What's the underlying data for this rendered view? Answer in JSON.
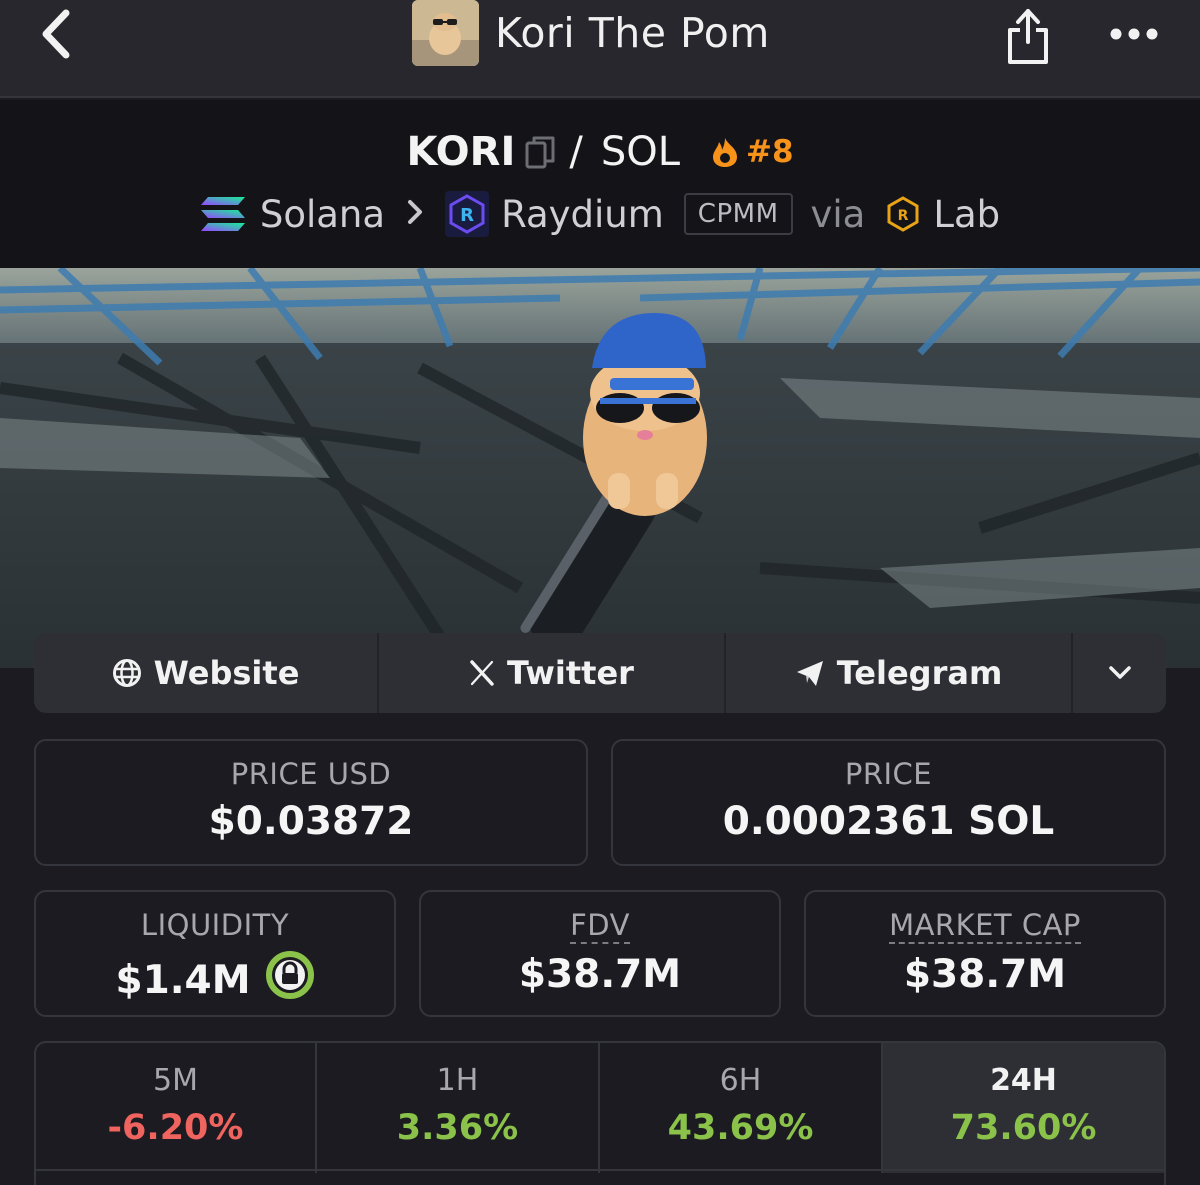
{
  "header": {
    "title": "Kori The Pom"
  },
  "pair": {
    "base": "KORI",
    "separator": "/",
    "quote": "SOL",
    "rank": "#8",
    "chain": "Solana",
    "dex": "Raydium",
    "pool_type": "CPMM",
    "via_label": "via",
    "launchpad": "Lab"
  },
  "links": {
    "website": "Website",
    "twitter": "Twitter",
    "telegram": "Telegram"
  },
  "stats": {
    "price_usd_label": "PRICE USD",
    "price_usd": "$0.03872",
    "price_label": "PRICE",
    "price_native": "0.0002361 SOL",
    "liquidity_label": "LIQUIDITY",
    "liquidity": "$1.4M",
    "fdv_label": "FDV",
    "fdv": "$38.7M",
    "mcap_label": "MARKET CAP",
    "mcap": "$38.7M"
  },
  "timeframes": [
    {
      "label": "5M",
      "change": "-6.20%",
      "color": "#f0645f",
      "active": false
    },
    {
      "label": "1H",
      "change": "3.36%",
      "color": "#8ac24a",
      "active": false
    },
    {
      "label": "6H",
      "change": "43.69%",
      "color": "#8ac24a",
      "active": false
    },
    {
      "label": "24H",
      "change": "73.60%",
      "color": "#8ac24a",
      "active": true
    }
  ],
  "colors": {
    "accent_orange": "#f7931a",
    "positive": "#8ac24a",
    "negative": "#f0645f",
    "lock_green": "#8ac24a"
  },
  "icons": [
    "back-icon",
    "avatar-image",
    "share-icon",
    "more-icon",
    "copy-icon",
    "flame-icon",
    "solana-icon",
    "chevron-right-icon",
    "raydium-icon",
    "lab-icon",
    "globe-icon",
    "x-icon",
    "telegram-icon",
    "chevron-down-icon",
    "lock-icon"
  ]
}
